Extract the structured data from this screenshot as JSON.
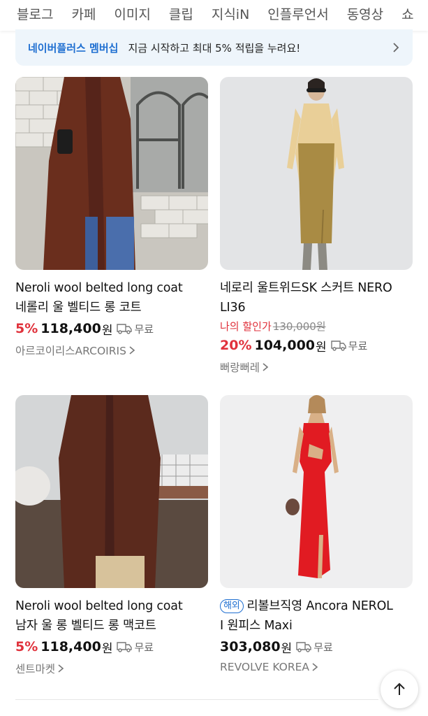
{
  "tabs": [
    "블로그",
    "카페",
    "이미지",
    "클립",
    "지식iN",
    "인플루언서",
    "동영상",
    "쇼"
  ],
  "banner": {
    "brand": "네이버플러스 멤버십",
    "message": "지금 시작하고 최대 5% 적립을 누려요!"
  },
  "products": [
    {
      "title_line1": "Neroli wool belted long coat",
      "title_line2": "네롤리 울 벨티드 롱 코트",
      "discount": "5%",
      "price": "118,400",
      "currency": "원",
      "shipping": "무료",
      "store": "아르코이리스ARCOIRIS"
    },
    {
      "title_line1": "네로리 울트위드SK 스커트 NERO",
      "title_line2": "LI36",
      "promo_label": "나의 할인가",
      "original_price": "130,000원",
      "discount": "20%",
      "price": "104,000",
      "currency": "원",
      "shipping": "무료",
      "store": "뻐랑뻐레"
    },
    {
      "title_line1": "Neroli wool belted long coat",
      "title_line2": "남자 울 롱 벨티드 롱 맥코트",
      "discount": "5%",
      "price": "118,400",
      "currency": "원",
      "shipping": "무료",
      "store": "센트마켓"
    },
    {
      "badge": "해외",
      "title_line1": "리볼브직영 Ancora NEROL",
      "title_line2": "I 원피스 Maxi",
      "price": "303,080",
      "currency": "원",
      "shipping": "무료",
      "store": "REVOLVE KOREA"
    }
  ],
  "colors": {
    "accent_blue": "#1f6fd1",
    "discount_red": "#e0323c",
    "banner_bg": "#eef5fb"
  }
}
